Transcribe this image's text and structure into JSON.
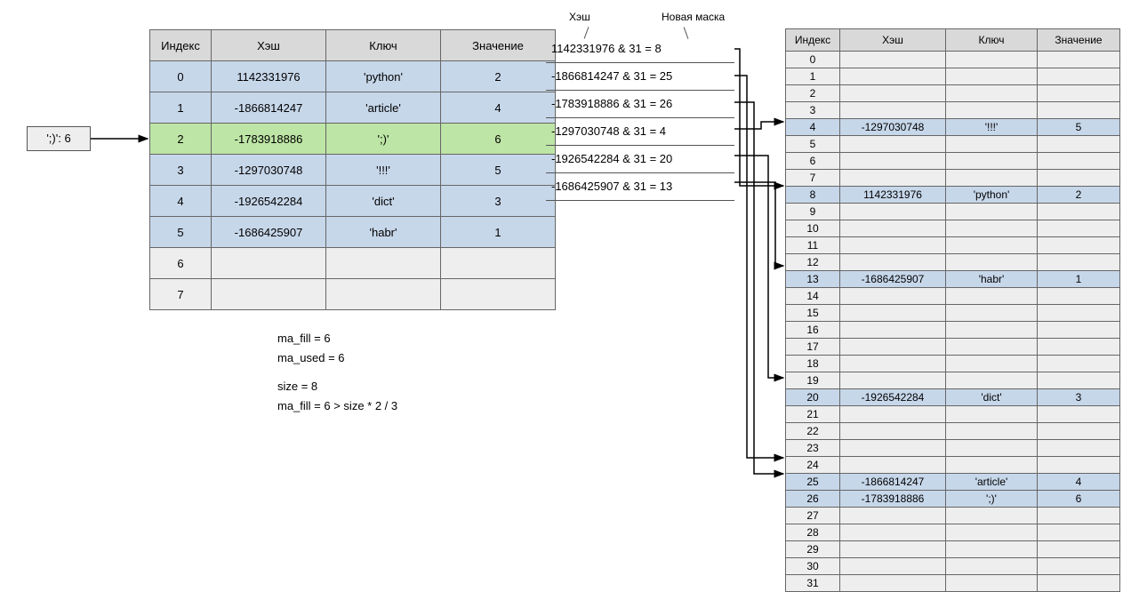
{
  "insert": {
    "label": "';)': 6"
  },
  "table8": {
    "headers": {
      "index": "Индекс",
      "hash": "Хэш",
      "key": "Ключ",
      "value": "Значение"
    },
    "rows": [
      {
        "index": "0",
        "hash": "1142331976",
        "key": "'python'",
        "value": "2",
        "style": "blue"
      },
      {
        "index": "1",
        "hash": "-1866814247",
        "key": "'article'",
        "value": "4",
        "style": "blue"
      },
      {
        "index": "2",
        "hash": "-1783918886",
        "key": "';)'",
        "value": "6",
        "style": "green"
      },
      {
        "index": "3",
        "hash": "-1297030748",
        "key": "'!!!'",
        "value": "5",
        "style": "blue"
      },
      {
        "index": "4",
        "hash": "-1926542284",
        "key": "'dict'",
        "value": "3",
        "style": "blue"
      },
      {
        "index": "5",
        "hash": "-1686425907",
        "key": "'habr'",
        "value": "1",
        "style": "blue"
      },
      {
        "index": "6",
        "hash": "",
        "key": "",
        "value": "",
        "style": "empty"
      },
      {
        "index": "7",
        "hash": "",
        "key": "",
        "value": "",
        "style": "empty"
      }
    ]
  },
  "calc": {
    "label_hash": "Хэш",
    "label_mask": "Новая маска",
    "rows": [
      {
        "text": "1142331976 & 31 = 8",
        "target": 8
      },
      {
        "text": "-1866814247 & 31 = 25",
        "target": 25
      },
      {
        "text": "-1783918886 & 31 = 26",
        "target": 26
      },
      {
        "text": "-1297030748 & 31 = 4",
        "target": 4
      },
      {
        "text": "-1926542284 & 31 = 20",
        "target": 20
      },
      {
        "text": "-1686425907 & 31 = 13",
        "target": 13
      }
    ]
  },
  "table32": {
    "headers": {
      "index": "Индекс",
      "hash": "Хэш",
      "key": "Ключ",
      "value": "Значение"
    },
    "fill": {
      "4": {
        "hash": "-1297030748",
        "key": "'!!!'",
        "value": "5"
      },
      "8": {
        "hash": "1142331976",
        "key": "'python'",
        "value": "2"
      },
      "13": {
        "hash": "-1686425907",
        "key": "'habr'",
        "value": "1"
      },
      "20": {
        "hash": "-1926542284",
        "key": "'dict'",
        "value": "3"
      },
      "25": {
        "hash": "-1866814247",
        "key": "'article'",
        "value": "4"
      },
      "26": {
        "hash": "-1783918886",
        "key": "';)'",
        "value": "6"
      }
    }
  },
  "info": {
    "line1": "ma_fill = 6",
    "line2": "ma_used = 6",
    "line3": "size = 8",
    "line4": "ma_fill = 6 > size * 2 / 3"
  },
  "chart_data": {
    "type": "diagram",
    "small_table_size": 8,
    "large_table_size": 32,
    "mask": 31,
    "items": [
      {
        "key": "python",
        "hash": 1142331976,
        "value": 2,
        "old_index": 0,
        "new_index": 8
      },
      {
        "key": "article",
        "hash": -1866814247,
        "value": 4,
        "old_index": 1,
        "new_index": 25
      },
      {
        "key": ";)",
        "hash": -1783918886,
        "value": 6,
        "old_index": 2,
        "new_index": 26
      },
      {
        "key": "!!!",
        "hash": -1297030748,
        "value": 5,
        "old_index": 3,
        "new_index": 4
      },
      {
        "key": "dict",
        "hash": -1926542284,
        "value": 3,
        "old_index": 4,
        "new_index": 20
      },
      {
        "key": "habr",
        "hash": -1686425907,
        "value": 1,
        "old_index": 5,
        "new_index": 13
      }
    ],
    "ma_fill": 6,
    "ma_used": 6,
    "size": 8,
    "resize_condition": "ma_fill > size * 2 / 3"
  }
}
